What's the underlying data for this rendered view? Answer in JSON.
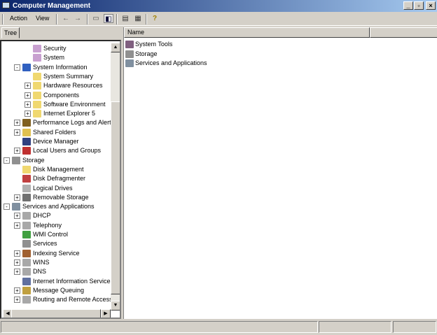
{
  "window": {
    "title": "Computer Management",
    "controls": [
      "_",
      "▫",
      "×"
    ]
  },
  "menu": {
    "action": "Action",
    "view": "View"
  },
  "tree": {
    "tab": "Tree",
    "items": [
      {
        "label": "Security",
        "level": 2,
        "exp": "",
        "icon": "event-log-icon"
      },
      {
        "label": "System",
        "level": 2,
        "exp": "",
        "icon": "event-log-icon"
      },
      {
        "label": "System Information",
        "level": 1,
        "exp": "-",
        "icon": "system-info-icon"
      },
      {
        "label": "System Summary",
        "level": 2,
        "exp": "",
        "icon": "folder-icon"
      },
      {
        "label": "Hardware Resources",
        "level": 2,
        "exp": "+",
        "icon": "folder-icon"
      },
      {
        "label": "Components",
        "level": 2,
        "exp": "+",
        "icon": "folder-icon"
      },
      {
        "label": "Software Environment",
        "level": 2,
        "exp": "+",
        "icon": "folder-icon"
      },
      {
        "label": "Internet Explorer 5",
        "level": 2,
        "exp": "+",
        "icon": "folder-icon"
      },
      {
        "label": "Performance Logs and Alerts",
        "level": 1,
        "exp": "+",
        "icon": "performance-icon"
      },
      {
        "label": "Shared Folders",
        "level": 1,
        "exp": "+",
        "icon": "shared-folder-icon"
      },
      {
        "label": "Device Manager",
        "level": 1,
        "exp": "",
        "icon": "device-manager-icon"
      },
      {
        "label": "Local Users and Groups",
        "level": 1,
        "exp": "+",
        "icon": "users-icon"
      },
      {
        "label": "Storage",
        "level": 0,
        "exp": "-",
        "icon": "storage-icon"
      },
      {
        "label": "Disk Management",
        "level": 1,
        "exp": "",
        "icon": "folder-icon"
      },
      {
        "label": "Disk Defragmenter",
        "level": 1,
        "exp": "",
        "icon": "defrag-icon"
      },
      {
        "label": "Logical Drives",
        "level": 1,
        "exp": "",
        "icon": "drive-icon"
      },
      {
        "label": "Removable Storage",
        "level": 1,
        "exp": "+",
        "icon": "removable-storage-icon"
      },
      {
        "label": "Services and Applications",
        "level": 0,
        "exp": "-",
        "icon": "services-apps-icon"
      },
      {
        "label": "DHCP",
        "level": 1,
        "exp": "+",
        "icon": "server-icon"
      },
      {
        "label": "Telephony",
        "level": 1,
        "exp": "+",
        "icon": "server-icon"
      },
      {
        "label": "WMI Control",
        "level": 1,
        "exp": "",
        "icon": "wmi-icon"
      },
      {
        "label": "Services",
        "level": 1,
        "exp": "",
        "icon": "services-icon"
      },
      {
        "label": "Indexing Service",
        "level": 1,
        "exp": "+",
        "icon": "indexing-icon"
      },
      {
        "label": "WINS",
        "level": 1,
        "exp": "+",
        "icon": "server-icon"
      },
      {
        "label": "DNS",
        "level": 1,
        "exp": "+",
        "icon": "server-icon"
      },
      {
        "label": "Internet Information Services",
        "level": 1,
        "exp": "",
        "icon": "iis-icon"
      },
      {
        "label": "Message Queuing",
        "level": 1,
        "exp": "+",
        "icon": "message-queue-icon"
      },
      {
        "label": "Routing and Remote Access",
        "level": 1,
        "exp": "+",
        "icon": "server-icon"
      }
    ]
  },
  "list": {
    "column": "Name",
    "items": [
      {
        "label": "System Tools",
        "icon": "system-tools-icon"
      },
      {
        "label": "Storage",
        "icon": "storage-icon"
      },
      {
        "label": "Services and Applications",
        "icon": "services-apps-icon"
      }
    ]
  },
  "icon_colors": {
    "folder-icon": "#f0d870",
    "event-log-icon": "#c8a0d0",
    "server-icon": "#a0a0a0",
    "users-icon": "#c03030",
    "storage-icon": "#909090"
  }
}
